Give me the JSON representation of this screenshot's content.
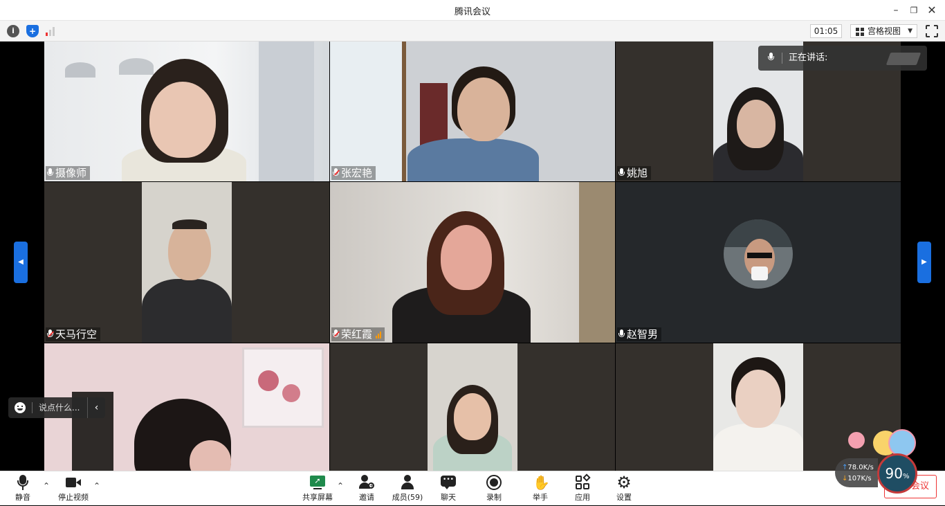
{
  "window": {
    "title": "腾讯会议"
  },
  "toolbar": {
    "timer": "01:05",
    "view_label": "宫格视图"
  },
  "speaking": {
    "label": "正在讲话:"
  },
  "participants": [
    {
      "name": "摄像师",
      "muted": false
    },
    {
      "name": "张宏艳",
      "muted": true
    },
    {
      "name": "姚旭",
      "muted": false
    },
    {
      "name": "天马行空",
      "muted": true
    },
    {
      "name": "荣红霞",
      "muted": true
    },
    {
      "name": "赵智男",
      "muted": false
    }
  ],
  "chat": {
    "placeholder": "说点什么..."
  },
  "controls": {
    "mute": "静音",
    "stop_video": "停止视频",
    "share_screen": "共享屏幕",
    "invite": "邀请",
    "members": "成员(59)",
    "chat": "聊天",
    "record": "录制",
    "raise_hand": "举手",
    "apps": "应用",
    "settings": "设置"
  },
  "network": {
    "upload": "78.0",
    "download": "107",
    "unit": "K/s",
    "quality_percent": "90",
    "percent_sign": "%"
  },
  "end_button": "会议",
  "colors": {
    "accent": "#1a6fe0",
    "danger": "#e33333",
    "tile_bg": "#34302c",
    "stage_bg": "#000000"
  }
}
